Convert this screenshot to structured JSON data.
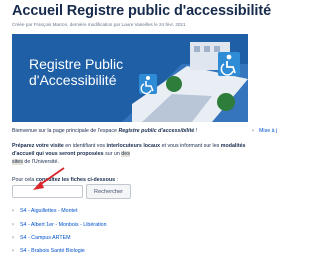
{
  "page": {
    "title": "Accueil Registre public d'accessibilité",
    "byline": "Créée par François Marron, dernière modification par Laure Vaireilles le 24 févr. 2021"
  },
  "banner": {
    "line1": "Registre Public",
    "line2": "d'Accessibilité"
  },
  "content": {
    "welcome_prefix": "Bienvenue sur la page principale de l'espace ",
    "welcome_bold": "Registre public d'accessibilité",
    "welcome_suffix": " !",
    "p1_bold1": "Préparez votre visite",
    "p1_t1": " en identifiant vos ",
    "p1_bold2": "interlocuteurs locaux",
    "p1_t2": " et vous informant sur les ",
    "p1_bold3": "modalités d'accueil qui vous seront proposées",
    "p1_t3": " sur un ",
    "p1_hl1": "des",
    "p1_hl2": "sites",
    "p1_t4": " de l'Université.",
    "consult_prefix": "Pour cela ",
    "consult_bold": "consultez les fiches ci-dessous",
    "consult_suffix": " :"
  },
  "search": {
    "placeholder": "",
    "button_label": "Rechercher"
  },
  "tree": [
    {
      "label": "S4 - Aiguillettes - Montet"
    },
    {
      "label": "S4 - Albert 1er - Monbois - Libération"
    },
    {
      "label": "S4 - Campus ARTEM"
    },
    {
      "label": "S4 - Brabois Santé Biologie"
    }
  ],
  "sidebar": {
    "link_label": "Mise à j"
  },
  "colors": {
    "banner_bg": "#1e5fa6",
    "link": "#0052cc",
    "arrow": "#d9262b",
    "access_icon": "#2e8bd6"
  }
}
